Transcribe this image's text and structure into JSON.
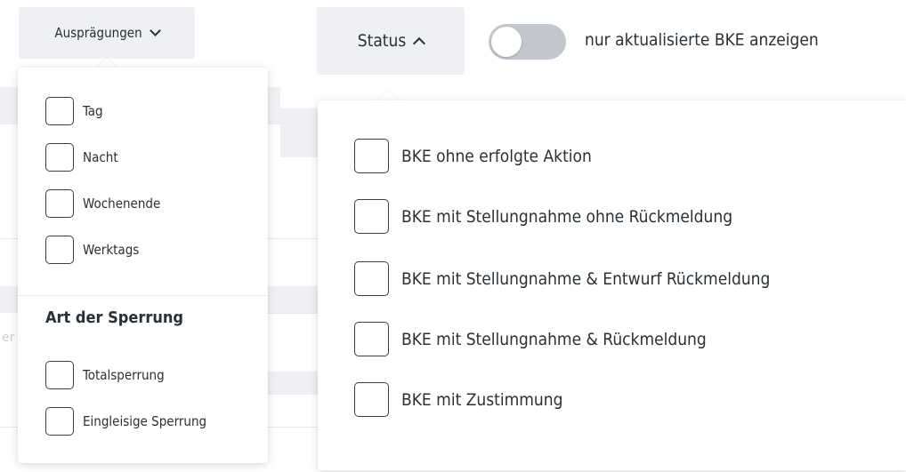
{
  "header": {
    "auspraegungen_label": "Ausprägungen",
    "status_label": "Status",
    "toggle": {
      "label": "nur aktualisierte BKE anzeigen",
      "checked": false
    }
  },
  "auspraegungen_menu": {
    "options": [
      {
        "label": "Tag",
        "checked": false
      },
      {
        "label": "Nacht",
        "checked": false
      },
      {
        "label": "Wochenende",
        "checked": false
      },
      {
        "label": "Werktags",
        "checked": false
      }
    ],
    "sperrung_heading": "Art der Sperrung",
    "sperrung_options": [
      {
        "label": "Totalsperrung",
        "checked": false
      },
      {
        "label": "Eingleisige Sperrung",
        "checked": false
      }
    ]
  },
  "status_menu": {
    "options": [
      {
        "label": "BKE ohne erfolgte Aktion",
        "checked": false
      },
      {
        "label": "BKE mit Stellungnahme ohne Rückmeldung",
        "checked": false
      },
      {
        "label": "BKE mit Stellungnahme & Entwurf Rückmeldung",
        "checked": false
      },
      {
        "label": "BKE mit Stellungnahme & Rückmeldung",
        "checked": false
      },
      {
        "label": "BKE mit Zustimmung",
        "checked": false
      }
    ]
  },
  "background": {
    "partial_text": "er",
    "colors": {
      "chip_yellow": "#f7d79c",
      "chip_blue": "#9fb8e6"
    }
  },
  "icons": {
    "auspraegungen_chevron": "chevron-down-icon",
    "status_chevron": "chevron-up-icon",
    "background_list": "list-icon"
  }
}
